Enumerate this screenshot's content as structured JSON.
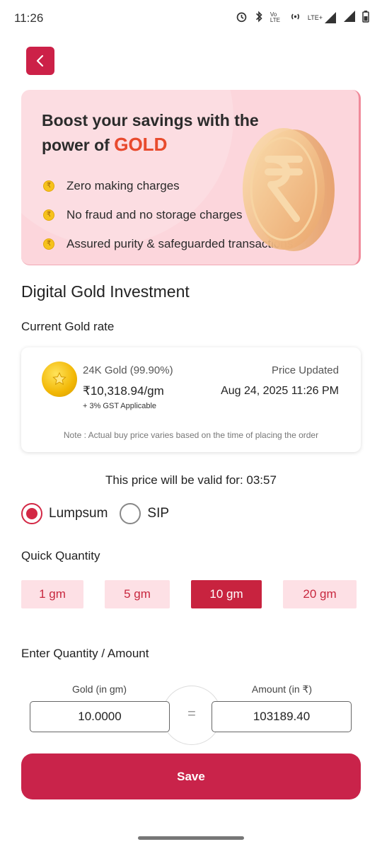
{
  "status_bar": {
    "time": "11:26",
    "icons": [
      "alarm-icon",
      "bluetooth-icon",
      "volte-icon",
      "hotspot-icon",
      "lte-signal-icon",
      "signal-icon",
      "battery-icon"
    ],
    "volte_text": "Vo LTE",
    "lte_text": "LTE+"
  },
  "banner": {
    "title_part1": "Boost your savings with the",
    "title_part2": "power of",
    "title_highlight": "GOLD",
    "features": [
      "Zero making charges",
      "No fraud and no storage charges",
      "Assured purity & safeguarded transactions"
    ],
    "bullet_symbol": "₹"
  },
  "page": {
    "title": "Digital Gold Investment",
    "rate_section_title": "Current Gold rate"
  },
  "rate_card": {
    "gold_type": "24K Gold (99.90%)",
    "price": "₹10,318.94/gm",
    "gst_note": "+ 3% GST Applicable",
    "updated_label": "Price Updated",
    "updated_date": "Aug 24, 2025 11:26 PM",
    "note": "Note : Actual buy price varies based on the time of placing the order"
  },
  "validity": {
    "text": "This price will be valid for: 03:57"
  },
  "plan_type": {
    "options": [
      "Lumpsum",
      "SIP"
    ],
    "selected": "Lumpsum"
  },
  "quick_quantity": {
    "title": "Quick Quantity",
    "chips": [
      "1 gm",
      "5 gm",
      "10 gm",
      "20 gm"
    ],
    "selected": "10 gm"
  },
  "entry": {
    "title": "Enter Quantity / Amount",
    "gold_label": "Gold (in gm)",
    "gold_value": "10.0000",
    "amount_label": "Amount (in ₹)",
    "amount_value": "103189.40",
    "equals": "="
  },
  "actions": {
    "save_label": "Save"
  },
  "colors": {
    "primary": "#c9234a",
    "banner_bg": "#fcd6dc",
    "chip_bg": "#fde0e5"
  }
}
